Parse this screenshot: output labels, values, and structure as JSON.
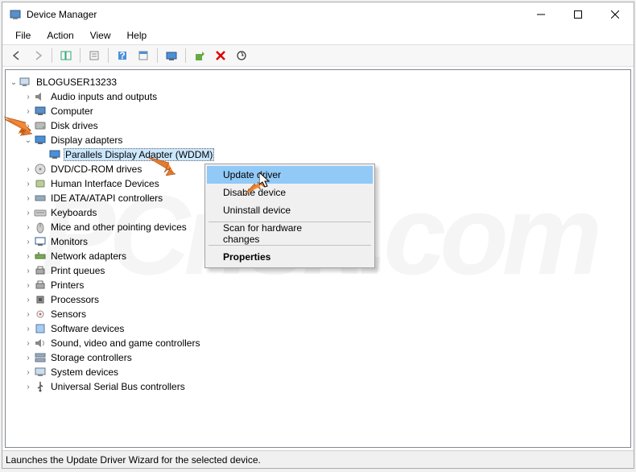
{
  "window": {
    "title": "Device Manager"
  },
  "menu": {
    "file": "File",
    "action": "Action",
    "view": "View",
    "help": "Help"
  },
  "tree": {
    "root": "BLOGUSER13233",
    "items": [
      {
        "label": "Audio inputs and outputs",
        "icon": "speaker"
      },
      {
        "label": "Computer",
        "icon": "computer"
      },
      {
        "label": "Disk drives",
        "icon": "disk"
      },
      {
        "label": "Display adapters",
        "icon": "display",
        "expanded": true,
        "children": [
          {
            "label": "Parallels Display Adapter (WDDM)",
            "icon": "display",
            "selected": true
          }
        ]
      },
      {
        "label": "DVD/CD-ROM drives",
        "icon": "cdrom"
      },
      {
        "label": "Human Interface Devices",
        "icon": "hid"
      },
      {
        "label": "IDE ATA/ATAPI controllers",
        "icon": "ide"
      },
      {
        "label": "Keyboards",
        "icon": "keyboard"
      },
      {
        "label": "Mice and other pointing devices",
        "icon": "mouse"
      },
      {
        "label": "Monitors",
        "icon": "monitor"
      },
      {
        "label": "Network adapters",
        "icon": "network"
      },
      {
        "label": "Print queues",
        "icon": "printer"
      },
      {
        "label": "Printers",
        "icon": "printer"
      },
      {
        "label": "Processors",
        "icon": "cpu"
      },
      {
        "label": "Sensors",
        "icon": "sensor"
      },
      {
        "label": "Software devices",
        "icon": "software"
      },
      {
        "label": "Sound, video and game controllers",
        "icon": "sound"
      },
      {
        "label": "Storage controllers",
        "icon": "storage"
      },
      {
        "label": "System devices",
        "icon": "system"
      },
      {
        "label": "Universal Serial Bus controllers",
        "icon": "usb"
      }
    ]
  },
  "context_menu": {
    "update": "Update driver",
    "disable": "Disable device",
    "uninstall": "Uninstall device",
    "scan": "Scan for hardware changes",
    "properties": "Properties"
  },
  "status": "Launches the Update Driver Wizard for the selected device.",
  "watermark": "PCrisk.com"
}
